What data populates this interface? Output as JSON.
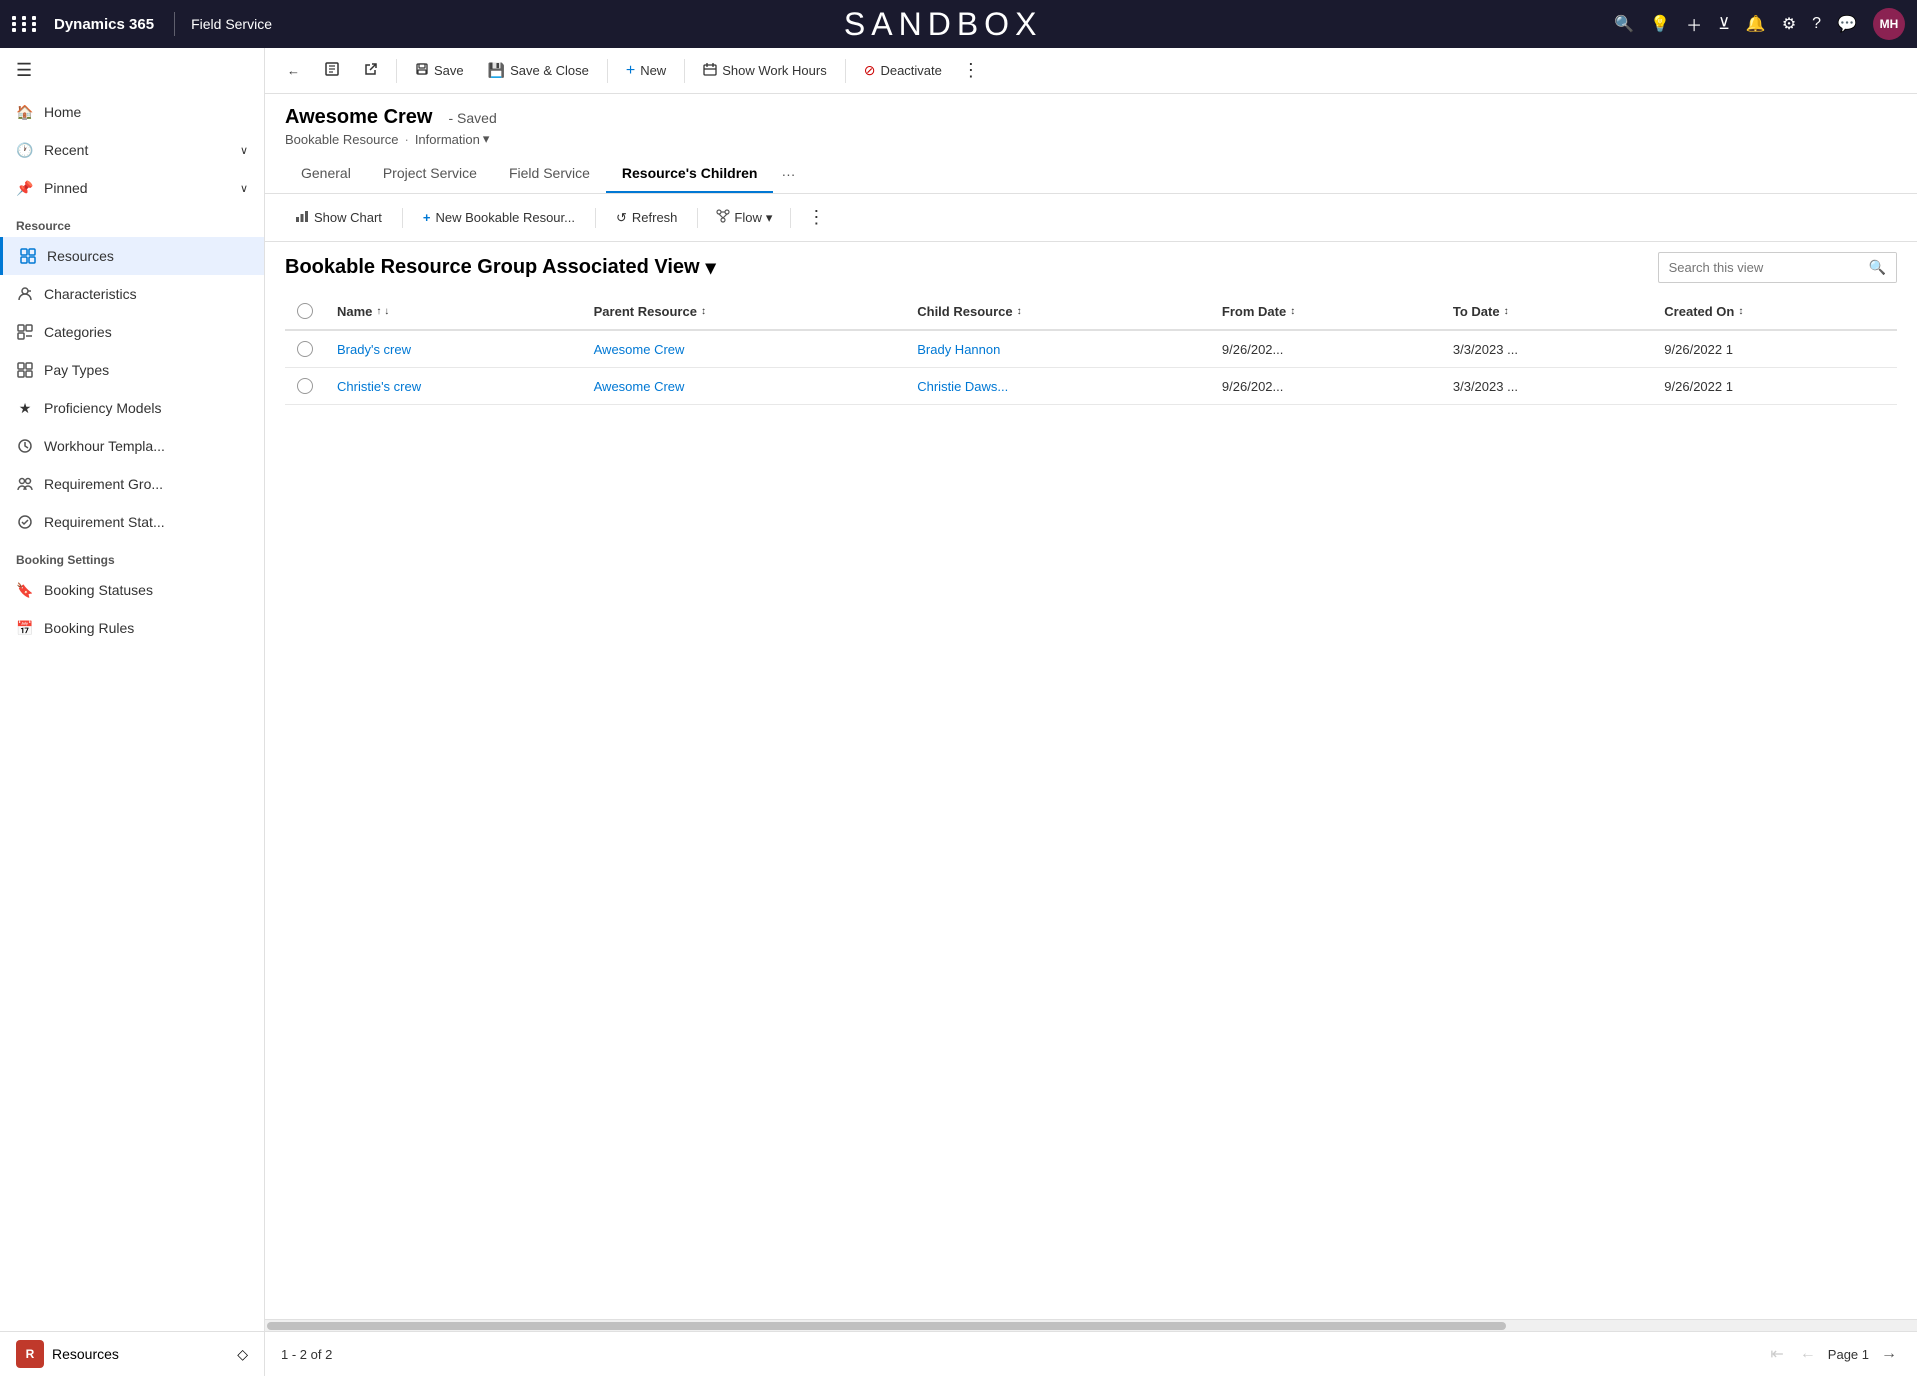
{
  "topNav": {
    "brand": "Dynamics 365",
    "module": "Field Service",
    "sandbox": "SANDBOX",
    "avatarInitials": "MH"
  },
  "sidebar": {
    "hamburgerIcon": "☰",
    "navItems": [
      {
        "id": "home",
        "label": "Home",
        "icon": "home"
      },
      {
        "id": "recent",
        "label": "Recent",
        "icon": "clock",
        "hasCaret": true
      },
      {
        "id": "pinned",
        "label": "Pinned",
        "icon": "pin",
        "hasCaret": true
      }
    ],
    "resourceSection": {
      "label": "Resource",
      "items": [
        {
          "id": "resources",
          "label": "Resources",
          "icon": "grid",
          "active": true
        },
        {
          "id": "characteristics",
          "label": "Characteristics",
          "icon": "person-tag"
        },
        {
          "id": "categories",
          "label": "Categories",
          "icon": "category"
        },
        {
          "id": "pay-types",
          "label": "Pay Types",
          "icon": "pay"
        },
        {
          "id": "proficiency-models",
          "label": "Proficiency Models",
          "icon": "star"
        },
        {
          "id": "workhour-templates",
          "label": "Workhour Templa...",
          "icon": "clock2"
        },
        {
          "id": "requirement-groups",
          "label": "Requirement Gro...",
          "icon": "req-group"
        },
        {
          "id": "requirement-statuses",
          "label": "Requirement Stat...",
          "icon": "req-status"
        }
      ]
    },
    "bookingSection": {
      "label": "Booking Settings",
      "items": [
        {
          "id": "booking-statuses",
          "label": "Booking Statuses",
          "icon": "bookmark"
        },
        {
          "id": "booking-rules",
          "label": "Booking Rules",
          "icon": "calendar-rule"
        }
      ]
    },
    "bottomItem": {
      "initial": "R",
      "label": "Resources",
      "caretIcon": "◇"
    }
  },
  "toolbar": {
    "backLabel": "←",
    "buttons": [
      {
        "id": "record-view",
        "icon": "📄",
        "label": ""
      },
      {
        "id": "open-new-window",
        "icon": "↗",
        "label": ""
      },
      {
        "id": "save",
        "icon": "💾",
        "label": "Save"
      },
      {
        "id": "save-close",
        "icon": "💾",
        "label": "Save & Close"
      },
      {
        "id": "new",
        "icon": "+",
        "label": "New"
      },
      {
        "id": "show-work-hours",
        "icon": "📅",
        "label": "Show Work Hours"
      },
      {
        "id": "deactivate",
        "icon": "🔴",
        "label": "Deactivate"
      }
    ],
    "moreLabel": "⋮"
  },
  "recordHeader": {
    "title": "Awesome Crew",
    "savedStatus": "- Saved",
    "breadcrumb1": "Bookable Resource",
    "breadcrumb2": "Information"
  },
  "tabs": [
    {
      "id": "general",
      "label": "General",
      "active": false
    },
    {
      "id": "project-service",
      "label": "Project Service",
      "active": false
    },
    {
      "id": "field-service",
      "label": "Field Service",
      "active": false
    },
    {
      "id": "resources-children",
      "label": "Resource's Children",
      "active": true
    }
  ],
  "subToolbar": {
    "buttons": [
      {
        "id": "show-chart",
        "icon": "📊",
        "label": "Show Chart"
      },
      {
        "id": "new-bookable-resource",
        "icon": "+",
        "label": "New Bookable Resour..."
      },
      {
        "id": "refresh",
        "icon": "↺",
        "label": "Refresh"
      }
    ],
    "flow": {
      "label": "Flow",
      "caretIcon": "▾"
    },
    "moreLabel": "⋮"
  },
  "gridHeader": {
    "viewTitle": "Bookable Resource Group Associated View",
    "caretIcon": "▾",
    "search": {
      "placeholder": "Search this view",
      "icon": "🔍"
    }
  },
  "table": {
    "columns": [
      {
        "id": "name",
        "label": "Name",
        "sortIcon": "↑↓"
      },
      {
        "id": "parent-resource",
        "label": "Parent Resource",
        "sortIcon": "↕"
      },
      {
        "id": "child-resource",
        "label": "Child Resource",
        "sortIcon": "↕"
      },
      {
        "id": "from-date",
        "label": "From Date",
        "sortIcon": "↕"
      },
      {
        "id": "to-date",
        "label": "To Date",
        "sortIcon": "↕"
      },
      {
        "id": "created-on",
        "label": "Created On",
        "sortIcon": "↕"
      }
    ],
    "rows": [
      {
        "name": "Brady's crew",
        "parentResource": "Awesome Crew",
        "childResource": "Brady Hannon",
        "fromDate": "9/26/202...",
        "toDate": "3/3/2023 ...",
        "createdOn": "9/26/2022 1"
      },
      {
        "name": "Christie's crew",
        "parentResource": "Awesome Crew",
        "childResource": "Christie Daws...",
        "fromDate": "9/26/202...",
        "toDate": "3/3/2023 ...",
        "createdOn": "9/26/2022 1"
      }
    ]
  },
  "footer": {
    "count": "1 - 2 of 2",
    "pageLabel": "Page 1"
  }
}
